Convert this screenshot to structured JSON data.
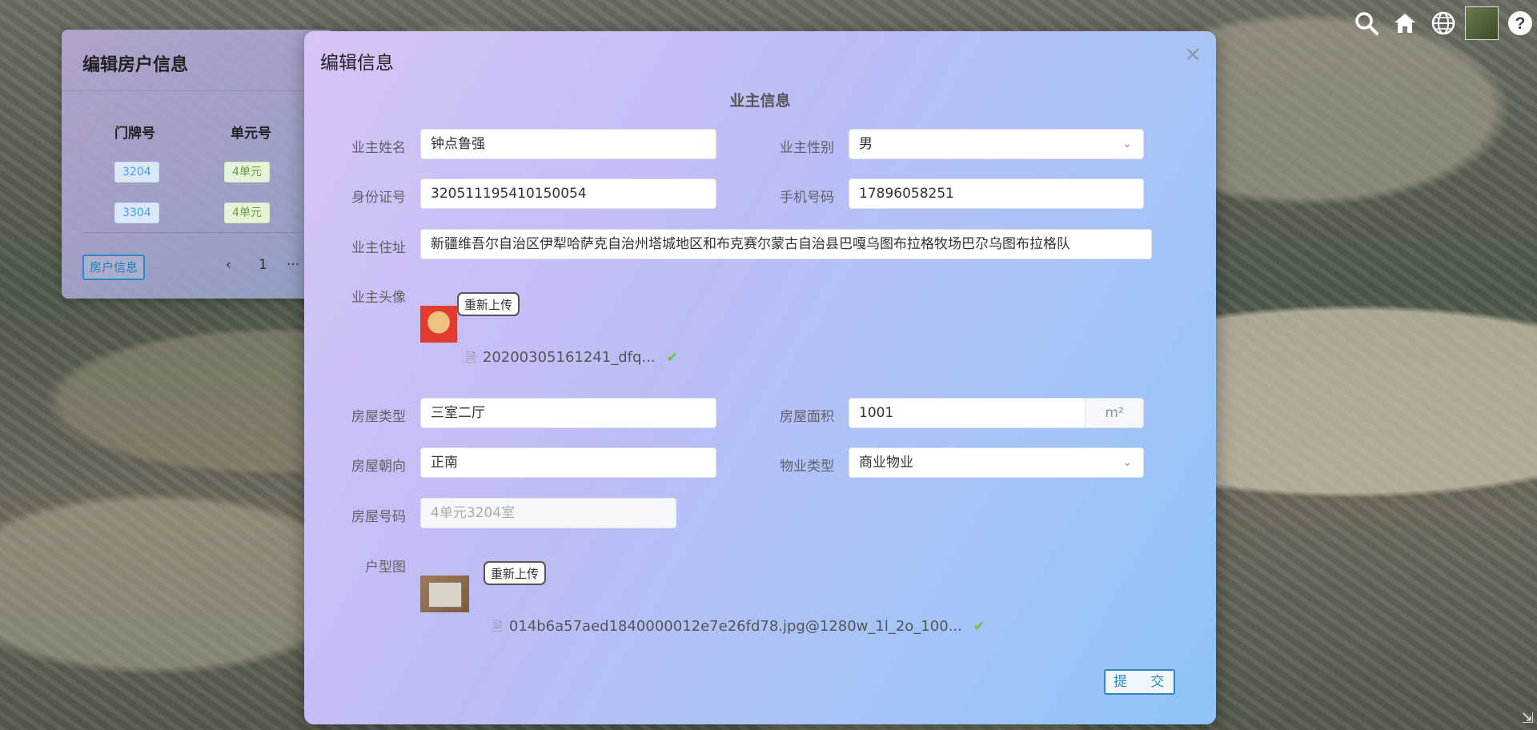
{
  "map_toolbar": {
    "icons": [
      "search-icon",
      "home-icon",
      "globe-icon",
      "map-layer-icon",
      "help-icon"
    ]
  },
  "house_panel": {
    "title": "编辑房户信息",
    "columns": [
      "门牌号",
      "单元号"
    ],
    "rows": [
      {
        "door": "3204",
        "unit": "4单元"
      },
      {
        "door": "3304",
        "unit": "4单元"
      }
    ],
    "house_info_button": "房户信息",
    "pager": {
      "prev": "‹",
      "page": "1",
      "more": "···"
    }
  },
  "dialog": {
    "title": "编辑信息",
    "section_title": "业主信息",
    "owner_name": {
      "label": "业主姓名",
      "value": "钟点鲁强"
    },
    "owner_gender": {
      "label": "业主性别",
      "value": "男"
    },
    "id_number": {
      "label": "身份证号",
      "value": "320511195410150054"
    },
    "phone": {
      "label": "手机号码",
      "value": "17896058251"
    },
    "address": {
      "label": "业主住址",
      "value": "新疆维吾尔自治区伊犁哈萨克自治州塔城地区和布克赛尔蒙古自治县巴嘎乌图布拉格牧场巴尕乌图布拉格队"
    },
    "avatar": {
      "label": "业主头像",
      "reupload": "重新上传",
      "file": "20200305161241_dfq..."
    },
    "house_type": {
      "label": "房屋类型",
      "value": "三室二厅"
    },
    "area": {
      "label": "房屋面积",
      "value": "1001",
      "unit": "m²"
    },
    "orientation": {
      "label": "房屋朝向",
      "value": "正南"
    },
    "property_type": {
      "label": "物业类型",
      "value": "商业物业"
    },
    "house_number": {
      "label": "房屋号码",
      "placeholder": "4单元3204室"
    },
    "floor_plan": {
      "label": "户型图",
      "reupload": "重新上传",
      "file": "014b6a57aed1840000012e7e26fd78.jpg@1280w_1l_2o_100..."
    },
    "submit": "提 交"
  }
}
